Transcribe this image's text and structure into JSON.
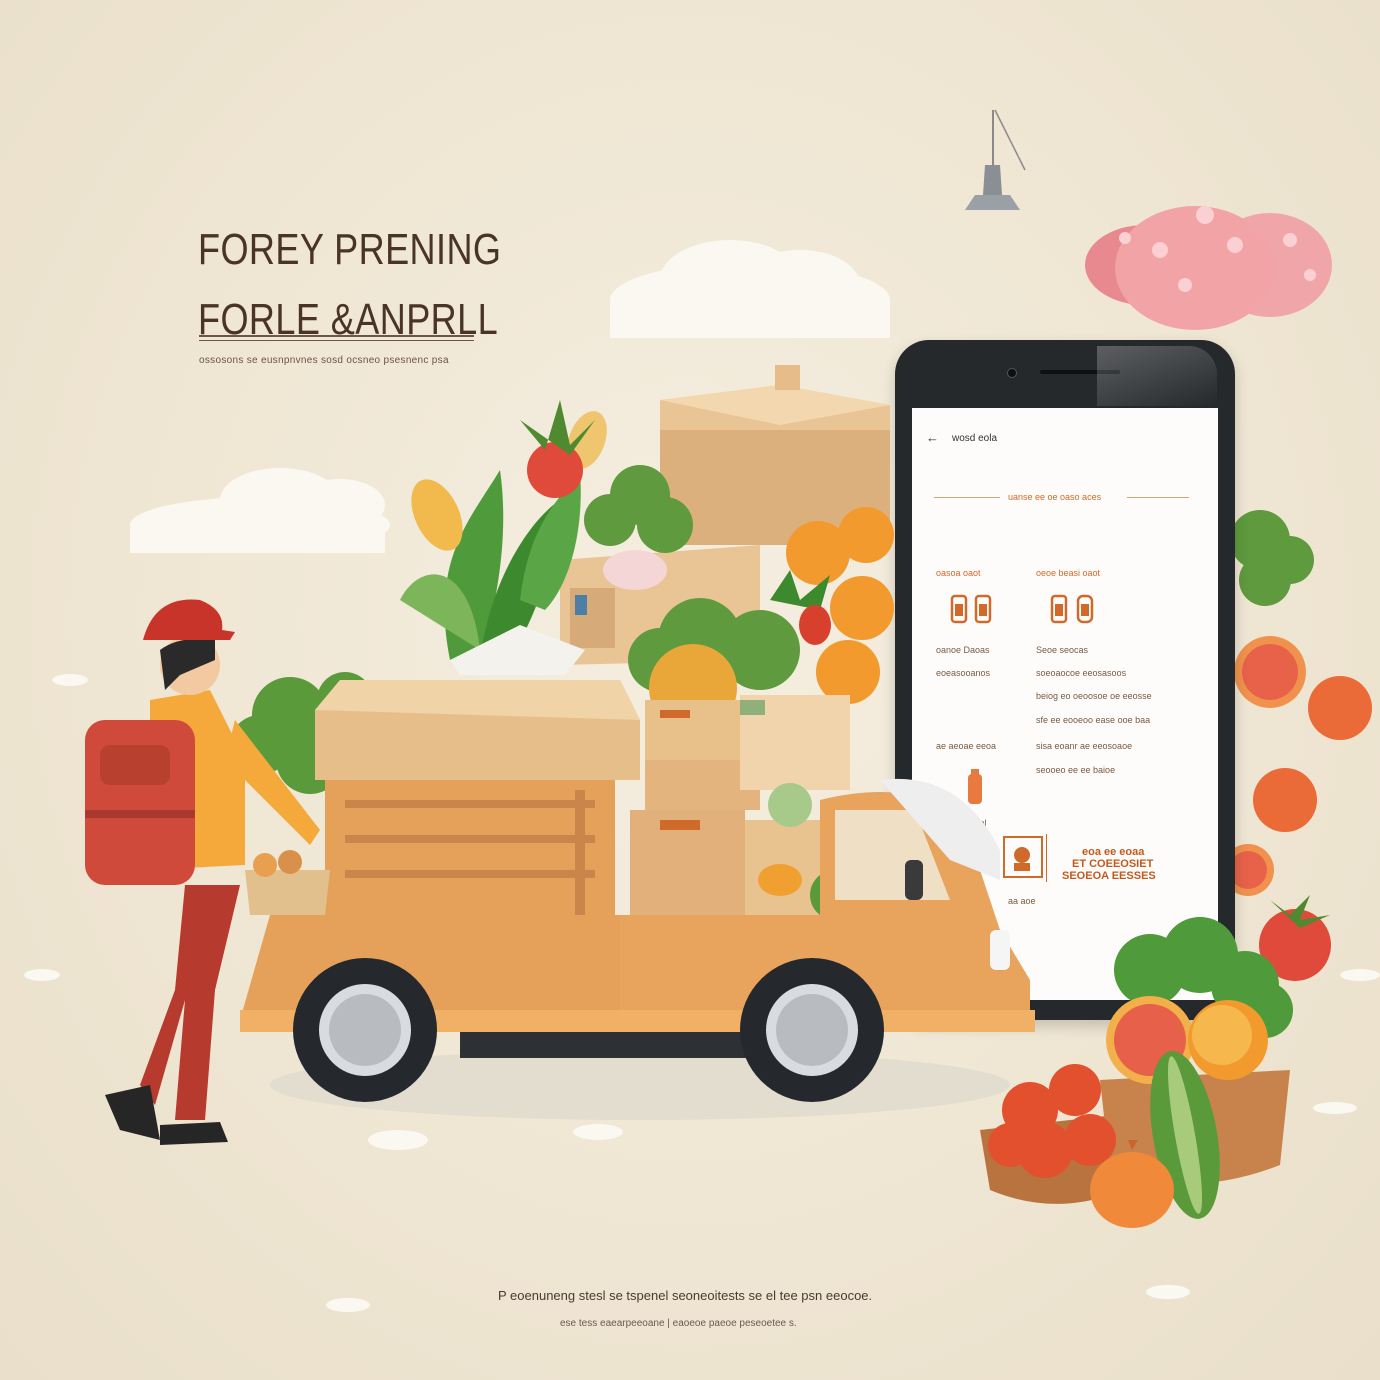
{
  "headline": {
    "line1": "FOREY PRENING",
    "line2": "FORLE &ANPRLL",
    "subline": "ossosons se eusnpnvnes sosd ocsneo psesnenc psa"
  },
  "phone_screen": {
    "back_icon": "arrow-left-icon",
    "header_title": "wosd eola",
    "section_title": "uanse ee oe oaso aces",
    "col1_title": "oasoa oaot",
    "col2_title": "oeoe beasi oaot",
    "col1_row1": "oanoe Daoas",
    "col1_row2": "eoeasooanos",
    "col2_row1": "Seoe seocas",
    "col2_row2": "soeoaocoe eeosasoos",
    "col2_row3": "beiog eo oeoosoe oe eeosse",
    "col2_row4": "sfe ee eooeoo ease ooe baa",
    "col1_row3": "ae aeoae eeoa",
    "col2_row5": "sisa eoanr ae eeosoaoe",
    "col2_row6": "seooeo ee ee baioe",
    "label_small": "ao eol",
    "promo_line1": "eoa ee eoaa",
    "promo_line2": "ET COEEOSIET",
    "promo_line3": "SEOEOA EESSES",
    "footer_text": "aa aoe"
  },
  "captions": {
    "line1": "P eoenuneng stesl se tspenel seoneoitests se el tee psn eeocoe.",
    "line2": "ese tess eaearpeeoane | eaoeoe paeoe peseoetee s."
  },
  "colors": {
    "background": "#efe6d3",
    "truck": "#e5a15a",
    "accent": "#d06a2a",
    "headline": "#4a3426"
  },
  "icons": [
    "cloud-icon",
    "lamp-icon",
    "delivery-person",
    "truck",
    "box",
    "smartphone",
    "vegetables",
    "fruits",
    "basket"
  ]
}
